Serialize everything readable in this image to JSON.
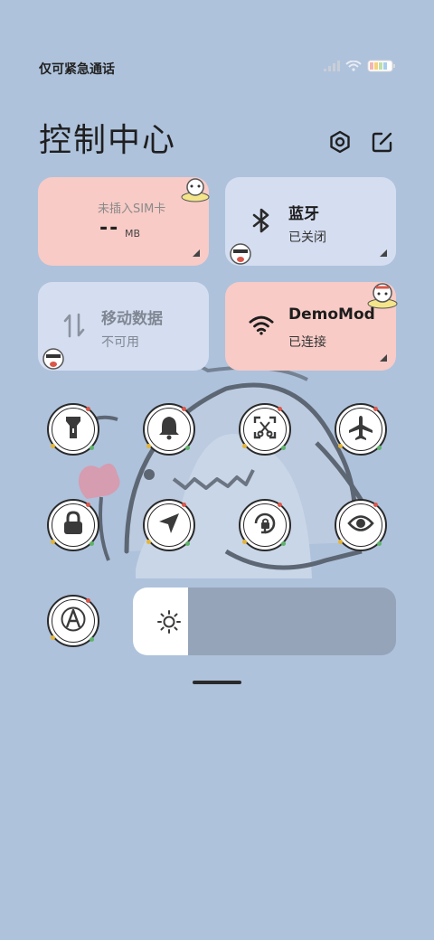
{
  "status_bar": {
    "carrier_text": "仅可紧急通话",
    "icons": [
      "signal-icon",
      "wifi-icon",
      "battery-icon"
    ]
  },
  "header": {
    "title": "控制中心",
    "settings_icon": "gear-icon",
    "edit_icon": "edit-icon"
  },
  "tiles": {
    "sim": {
      "label": "未插入SIM卡",
      "usage": "--",
      "unit": "MB"
    },
    "bluetooth": {
      "title": "蓝牙",
      "status": "已关闭",
      "icon": "bluetooth-icon"
    },
    "mobile_data": {
      "title": "移动数据",
      "status": "不可用",
      "icon": "mobile-data-icon"
    },
    "wifi": {
      "title": "DemoMod",
      "status": "已连接",
      "icon": "wifi-icon"
    }
  },
  "toggles": [
    {
      "name": "flashlight-icon"
    },
    {
      "name": "bell-icon"
    },
    {
      "name": "screenshot-icon"
    },
    {
      "name": "airplane-icon"
    },
    {
      "name": "lock-icon"
    },
    {
      "name": "location-icon"
    },
    {
      "name": "rotation-lock-icon"
    },
    {
      "name": "eye-icon"
    },
    {
      "name": "auto-brightness-icon"
    }
  ],
  "brightness": {
    "level": 0.21,
    "icon": "sun-icon"
  },
  "colors": {
    "background": "#aec2dc",
    "tile_pink": "#f8cbc6",
    "tile_blue": "#d5def0"
  }
}
